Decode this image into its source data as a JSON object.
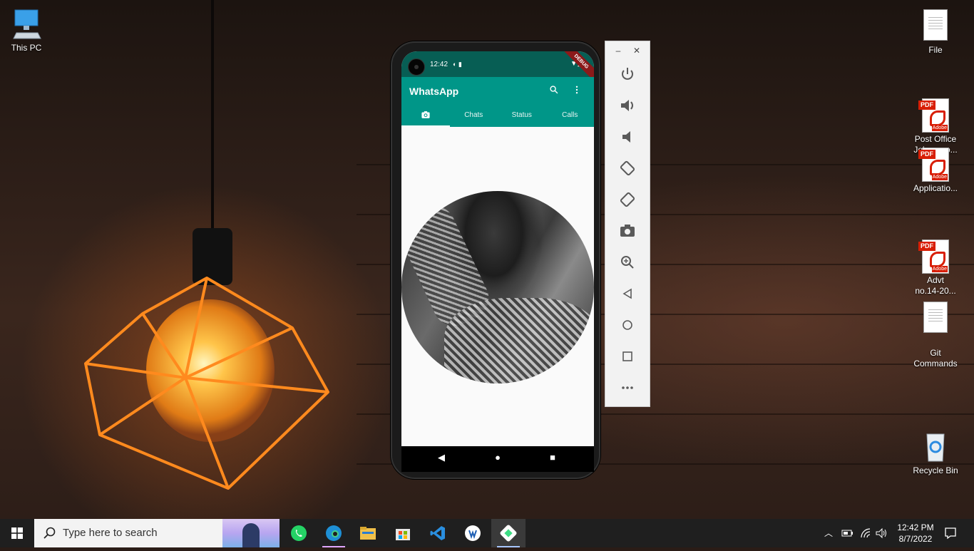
{
  "desktop": {
    "icons": [
      {
        "label": "This PC",
        "icon": "this-pc-icon"
      },
      {
        "label": "File",
        "icon": "text-file-icon"
      },
      {
        "label": "Post Office\nJobs as o...",
        "icon": "pdf-file-icon"
      },
      {
        "label": "Applicatio...",
        "icon": "pdf-file-icon"
      },
      {
        "label": "Advt\nno.14-20...",
        "icon": "pdf-file-icon"
      },
      {
        "label": "Git\nCommands",
        "icon": "text-file-icon"
      },
      {
        "label": "Recycle Bin",
        "icon": "recycle-bin-icon"
      }
    ],
    "pdf_tag": "PDF",
    "pdf_brand": "Adobe"
  },
  "phone": {
    "status": {
      "time": "12:42",
      "debug_label": "DEBUG"
    },
    "app": {
      "title": "WhatsApp",
      "tabs": [
        {
          "label": "",
          "icon": "camera-icon",
          "active": true
        },
        {
          "label": "Chats",
          "active": false
        },
        {
          "label": "Status",
          "active": false
        },
        {
          "label": "Calls",
          "active": false
        }
      ]
    }
  },
  "emulator_toolbar": {
    "window_buttons": [
      "minimize-icon",
      "close-icon"
    ],
    "buttons": [
      "power-icon",
      "volume-up-icon",
      "volume-down-icon",
      "rotate-left-icon",
      "rotate-right-icon",
      "screenshot-icon",
      "zoom-icon",
      "back-icon",
      "home-icon",
      "overview-icon",
      "more-icon"
    ]
  },
  "taskbar": {
    "search_placeholder": "Type here to search",
    "apps": [
      "whatsapp-icon",
      "edge-icon",
      "file-explorer-icon",
      "store-icon",
      "vscode-icon",
      "app-icon",
      "android-emulator-icon"
    ],
    "clock": {
      "time": "12:42 PM",
      "date": "8/7/2022"
    }
  },
  "colors": {
    "whatsapp_dark": "#075e54",
    "whatsapp_teal": "#009688",
    "taskbar": "#1f1f1f"
  }
}
